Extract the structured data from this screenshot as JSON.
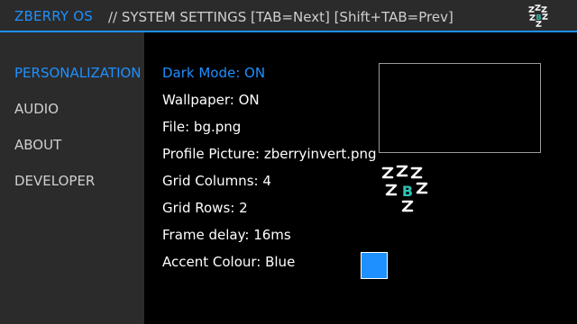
{
  "header": {
    "app_title": "ZBERRY OS",
    "breadcrumb": "// SYSTEM SETTINGS [TAB=Next] [Shift+TAB=Prev]",
    "logo_icon": "zberry-logo-icon"
  },
  "sidebar": {
    "items": [
      {
        "label": "PERSONALIZATION",
        "active": true
      },
      {
        "label": "AUDIO",
        "active": false
      },
      {
        "label": "ABOUT",
        "active": false
      },
      {
        "label": "DEVELOPER",
        "active": false
      }
    ]
  },
  "settings": [
    {
      "label": "Dark Mode: ON",
      "selected": true
    },
    {
      "label": "Wallpaper: ON",
      "selected": false
    },
    {
      "label": "File: bg.png",
      "selected": false
    },
    {
      "label": "Profile Picture: zberryinvert.png",
      "selected": false
    },
    {
      "label": "Grid Columns: 4",
      "selected": false
    },
    {
      "label": "Grid Rows: 2",
      "selected": false
    },
    {
      "label": "Frame delay: 16ms",
      "selected": false
    },
    {
      "label": "Accent Colour: Blue",
      "selected": false
    }
  ],
  "colors": {
    "accent": "#1e90ff",
    "panel": "#2b2b2b",
    "background": "#000000"
  }
}
